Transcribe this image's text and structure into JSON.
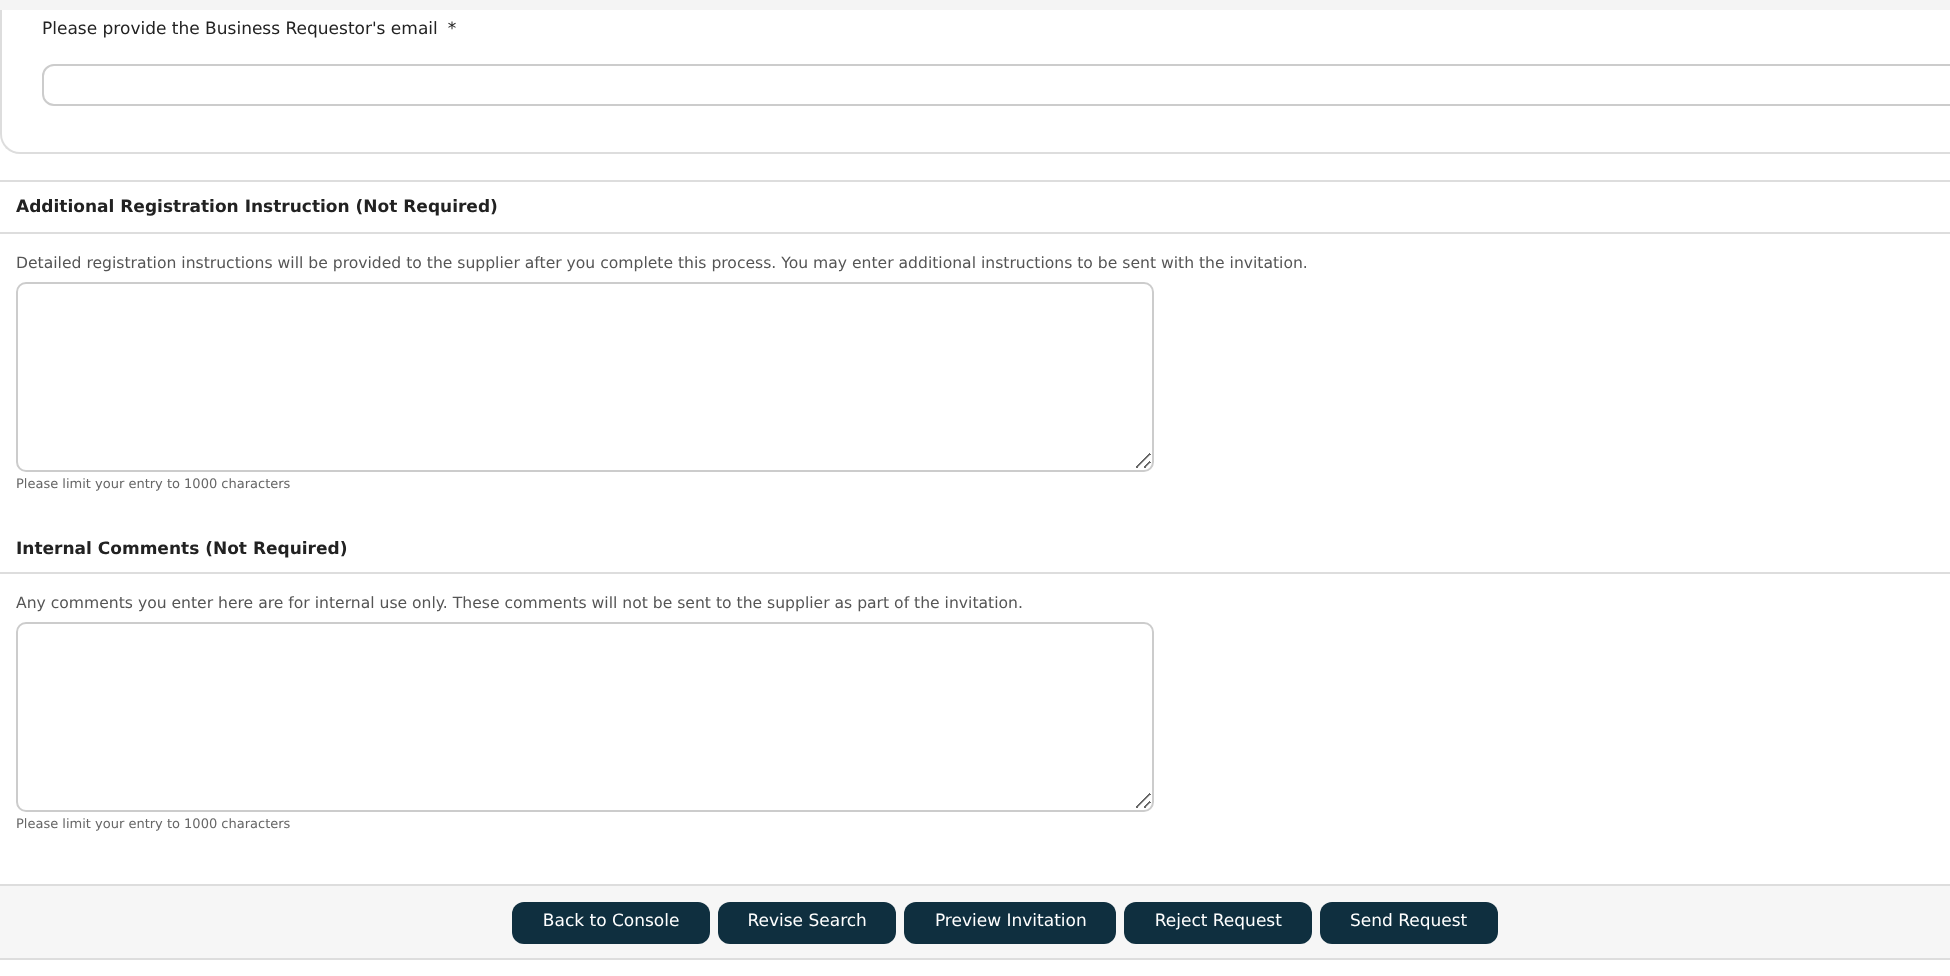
{
  "email_field": {
    "label": "Please provide the Business Requestor's email",
    "required_mark": "*"
  },
  "sections": [
    {
      "title": "Additional Registration Instruction (Not Required)",
      "description": "Detailed registration instructions will be provided to the supplier after you complete this process. You may enter additional instructions to be sent with the invitation.",
      "hint": "Please limit your entry to 1000 characters"
    },
    {
      "title": "Internal Comments (Not Required)",
      "description": "Any comments you enter here are for internal use only. These comments will not be sent to the supplier as part of the invitation.",
      "hint": "Please limit your entry to 1000 characters"
    }
  ],
  "buttons": [
    "Back to Console",
    "Revise Search",
    "Preview Invitation",
    "Reject Request",
    "Send Request"
  ]
}
